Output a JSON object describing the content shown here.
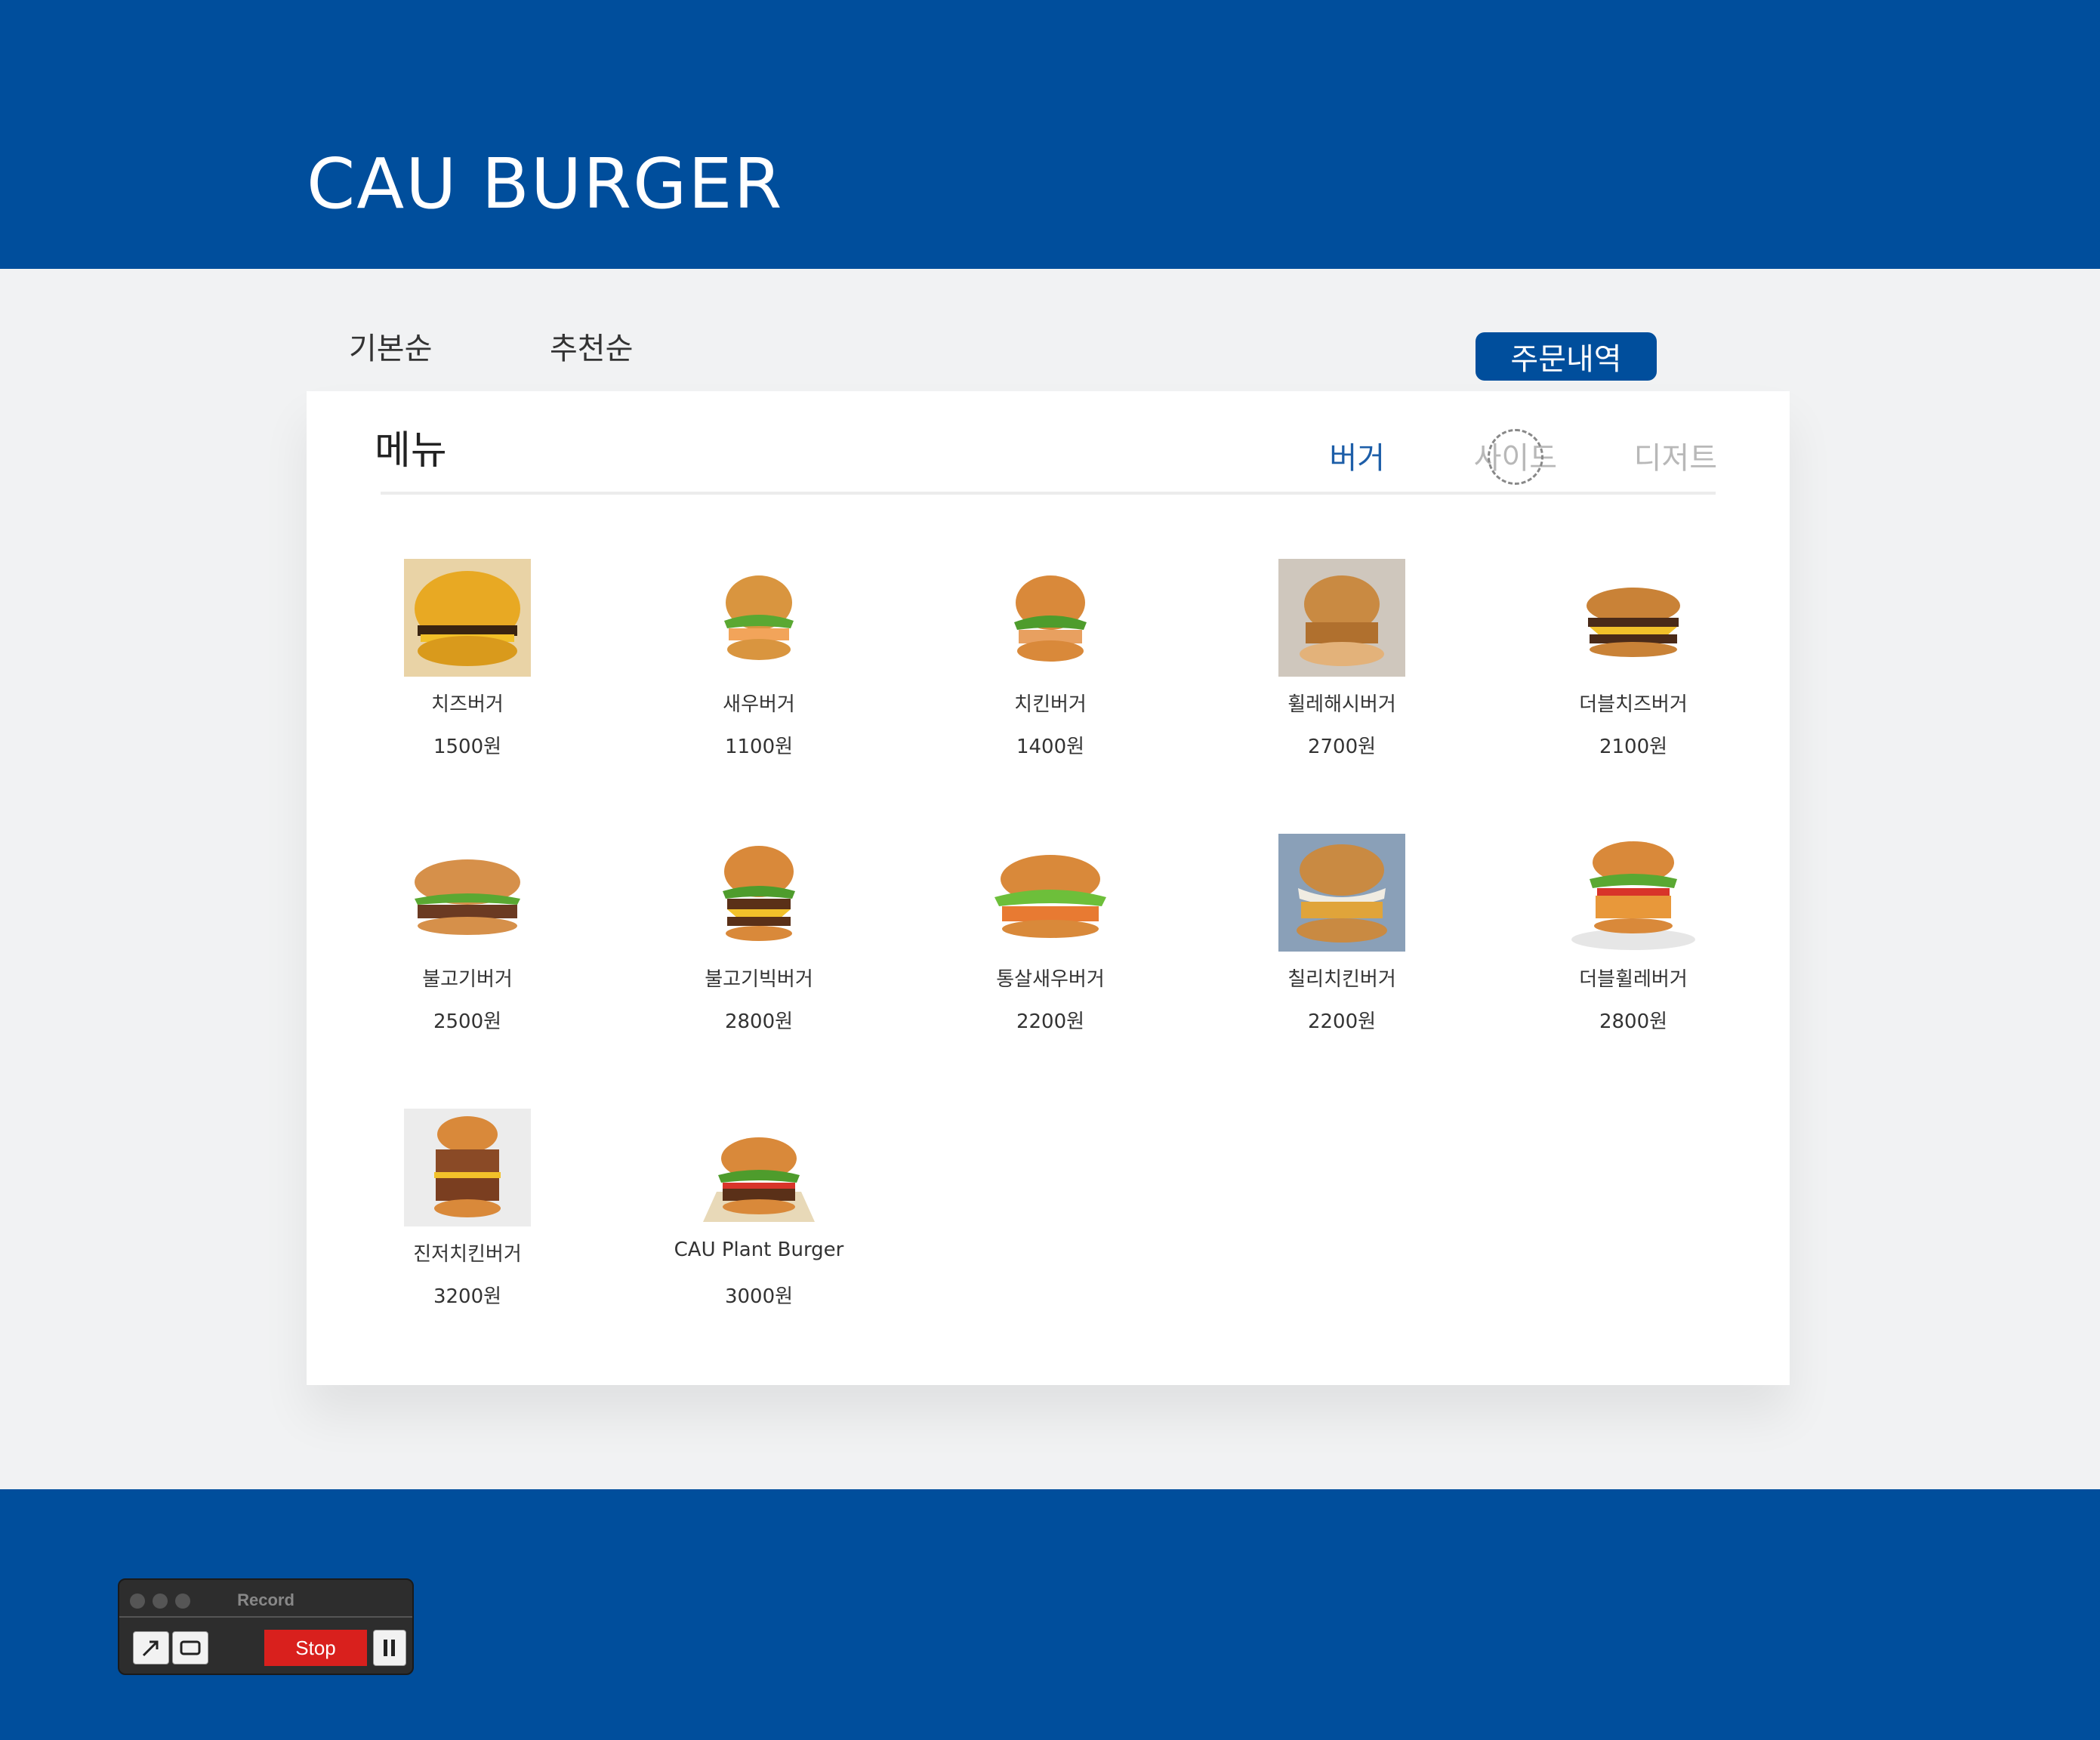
{
  "header": {
    "brand": "CAU BURGER"
  },
  "sort": {
    "default_label": "기본순",
    "recommend_label": "추천순",
    "order_history_label": "주문내역"
  },
  "menu": {
    "title": "메뉴",
    "categories": {
      "burger": "버거",
      "side": "사이드",
      "dessert": "디저트"
    },
    "items": [
      {
        "name": "치즈버거",
        "price": "1500원"
      },
      {
        "name": "새우버거",
        "price": "1100원"
      },
      {
        "name": "치킨버거",
        "price": "1400원"
      },
      {
        "name": "휠레해시버거",
        "price": "2700원"
      },
      {
        "name": "더블치즈버거",
        "price": "2100원"
      },
      {
        "name": "불고기버거",
        "price": "2500원"
      },
      {
        "name": "불고기빅버거",
        "price": "2800원"
      },
      {
        "name": "통살새우버거",
        "price": "2200원"
      },
      {
        "name": "칠리치킨버거",
        "price": "2200원"
      },
      {
        "name": "더블휠레버거",
        "price": "2800원"
      },
      {
        "name": "진저치킨버거",
        "price": "3200원"
      },
      {
        "name": "CAU Plant Burger",
        "price": "3000원"
      }
    ]
  },
  "recorder": {
    "title": "Record",
    "stop_label": "Stop"
  },
  "colors": {
    "brand_blue": "#004e9c",
    "active_tab": "#1d5ea8",
    "inactive_tab": "#b8b8b8",
    "stop_red": "#d9201d"
  },
  "icons": {
    "item_image": "burger-icon",
    "arrow_tool": "arrow-icon",
    "rect_tool": "rectangle-icon",
    "pause": "pause-icon"
  }
}
